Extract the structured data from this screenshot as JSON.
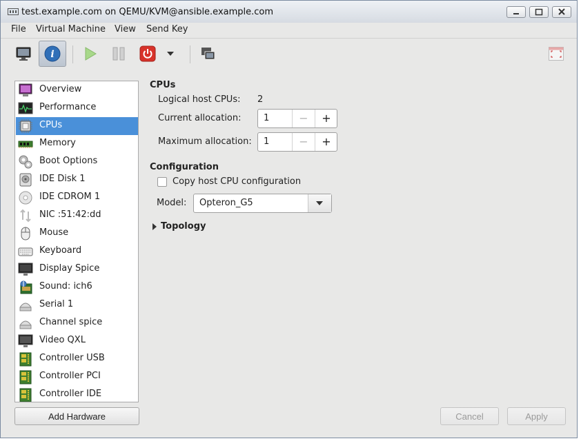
{
  "window": {
    "title": "test.example.com on QEMU/KVM@ansible.example.com"
  },
  "menubar": {
    "items": [
      "File",
      "Virtual Machine",
      "View",
      "Send Key"
    ]
  },
  "toolbar": {
    "icons": [
      "monitor-icon",
      "info-icon",
      "run-icon",
      "pause-icon",
      "power-icon",
      "dropdown-arrow-icon",
      "snapshots-icon",
      "fullscreen-icon"
    ]
  },
  "sidebar": {
    "selected": "CPUs",
    "items": [
      {
        "label": "Overview",
        "icon": "overview-icon"
      },
      {
        "label": "Performance",
        "icon": "performance-icon"
      },
      {
        "label": "CPUs",
        "icon": "cpu-icon"
      },
      {
        "label": "Memory",
        "icon": "memory-icon"
      },
      {
        "label": "Boot Options",
        "icon": "boot-options-icon"
      },
      {
        "label": "IDE Disk 1",
        "icon": "disk-icon"
      },
      {
        "label": "IDE CDROM 1",
        "icon": "cdrom-icon"
      },
      {
        "label": "NIC :51:42:dd",
        "icon": "nic-icon"
      },
      {
        "label": "Mouse",
        "icon": "mouse-icon"
      },
      {
        "label": "Keyboard",
        "icon": "keyboard-icon"
      },
      {
        "label": "Display Spice",
        "icon": "display-icon"
      },
      {
        "label": "Sound: ich6",
        "icon": "sound-icon"
      },
      {
        "label": "Serial 1",
        "icon": "serial-icon"
      },
      {
        "label": "Channel spice",
        "icon": "channel-icon"
      },
      {
        "label": "Video QXL",
        "icon": "video-icon"
      },
      {
        "label": "Controller USB",
        "icon": "controller-icon"
      },
      {
        "label": "Controller PCI",
        "icon": "controller-icon"
      },
      {
        "label": "Controller IDE",
        "icon": "controller-icon"
      }
    ],
    "add_hardware": "Add Hardware"
  },
  "cpus": {
    "title": "CPUs",
    "logical_host_label": "Logical host CPUs:",
    "logical_host_value": "2",
    "current_label": "Current allocation:",
    "current_value": "1",
    "maximum_label": "Maximum allocation:",
    "maximum_value": "1"
  },
  "configuration": {
    "title": "Configuration",
    "copy_host_label": "Copy host CPU configuration",
    "copy_host_checked": false,
    "model_label": "Model:",
    "model_value": "Opteron_G5"
  },
  "topology": {
    "label": "Topology",
    "expanded": false
  },
  "footer": {
    "cancel": "Cancel",
    "apply": "Apply"
  },
  "colors": {
    "selection": "#4a90d9",
    "window_bg": "#e8e8e7"
  }
}
